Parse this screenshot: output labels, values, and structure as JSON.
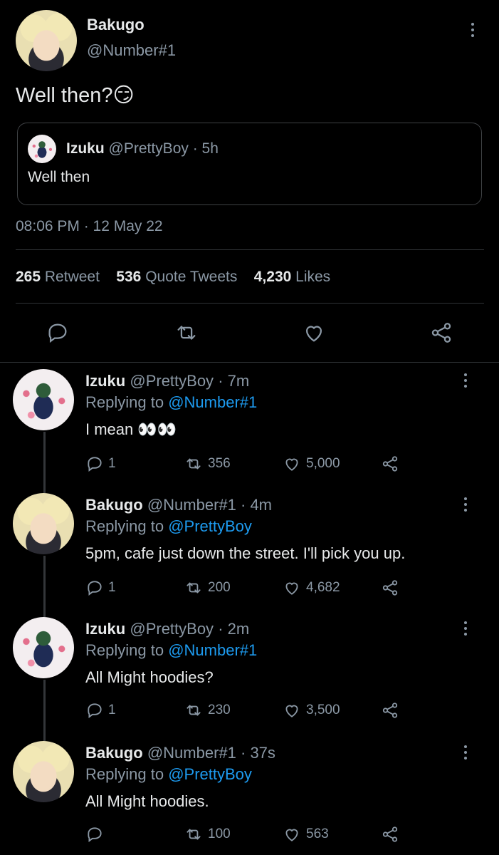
{
  "main_tweet": {
    "author_name": "Bakugo",
    "author_handle": "@Number#1",
    "text": "Well then?😏",
    "quote": {
      "author_name": "Izuku",
      "author_handle": "@PrettyBoy",
      "time": "· 5h",
      "text": "Well then"
    },
    "timestamp": "08:06 PM · 12 May 22",
    "stats": [
      {
        "count": "265",
        "label": "Retweet"
      },
      {
        "count": "536",
        "label": "Quote Tweets"
      },
      {
        "count": "4,230",
        "label": "Likes"
      }
    ]
  },
  "replies": [
    {
      "name": "Izuku",
      "handle": "@PrettyBoy",
      "time": "· 7m",
      "replying_prefix": "Replying to",
      "replying_to": "@Number#1",
      "text": "I mean 👀👀",
      "reply_count": "1",
      "retweet_count": "356",
      "like_count": "5,000"
    },
    {
      "name": "Bakugo",
      "handle": "@Number#1",
      "time": "· 4m",
      "replying_prefix": "Replying to",
      "replying_to": "@PrettyBoy",
      "text": "5pm, cafe just down the street. I'll pick you up.",
      "reply_count": "1",
      "retweet_count": "200",
      "like_count": "4,682"
    },
    {
      "name": "Izuku",
      "handle": "@PrettyBoy",
      "time": "· 2m",
      "replying_prefix": "Replying to",
      "replying_to": "@Number#1",
      "text": "All Might hoodies?",
      "reply_count": "1",
      "retweet_count": "230",
      "like_count": "3,500"
    },
    {
      "name": "Bakugo",
      "handle": "@Number#1",
      "time": "· 37s",
      "replying_prefix": "Replying to",
      "replying_to": "@PrettyBoy",
      "text": "All Might hoodies.",
      "reply_count": "",
      "retweet_count": "100",
      "like_count": "563"
    }
  ]
}
